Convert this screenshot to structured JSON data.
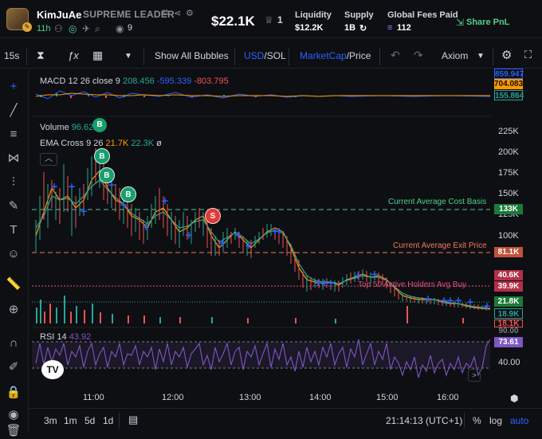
{
  "header": {
    "token_name": "KimJuAe",
    "token_full_name": "SUPREME LEADER",
    "age": "11h",
    "watchers": "9",
    "market_cap": "$22.1K",
    "holders_count": "1",
    "liquidity_label": "Liquidity",
    "liquidity_value": "$12.2K",
    "supply_label": "Supply",
    "supply_value": "1B",
    "fees_label": "Global Fees Paid",
    "fees_value": "112",
    "share_label": "Share PnL"
  },
  "toolbar": {
    "interval": "15s",
    "show_all_bubbles": "Show All Bubbles",
    "currency_usd": "USD",
    "currency_sep": "/",
    "currency_sol": "SOL",
    "mode_marketcap": "MarketCap",
    "mode_sep": "/",
    "mode_price": "Price",
    "source": "Axiom"
  },
  "indicators": {
    "macd_label": "MACD 12 26 close 9",
    "macd_v1": "208.456",
    "macd_v2": "-595.339",
    "macd_v3": "-803.795",
    "volume_label": "Volume",
    "volume_value": "96.62",
    "ema_label": "EMA Cross 9 26",
    "ema_v1": "21.7K",
    "ema_v2": "22.3K",
    "ema_v3": "ø",
    "rsi_label": "RSI 14",
    "rsi_value": "43.92"
  },
  "lines": {
    "avg_cost": "Current Average Cost Basis",
    "avg_exit": "Current Average Exit Price",
    "top50": "Top 50 Active Holders Avg Buy"
  },
  "axis": {
    "macd_tags": [
      "859.947",
      "704.083",
      "155.864"
    ],
    "price_ticks": [
      "225K",
      "200K",
      "175K",
      "150K",
      "125K",
      "100K"
    ],
    "price_tags": [
      "133K",
      "81.1K",
      "40.6K",
      "39.9K",
      "21.8K",
      "18.9K",
      "18.1K"
    ],
    "rsi_tags": [
      "73.61",
      "40.00",
      "90.00"
    ]
  },
  "time_axis": [
    "11:00",
    "12:00",
    "13:00",
    "14:00",
    "15:00",
    "16:00"
  ],
  "bottom": {
    "ranges": [
      "3m",
      "1m",
      "5d",
      "1d"
    ],
    "clock": "21:14:13 (UTC+1)",
    "percent": "%",
    "log": "log",
    "auto": "auto"
  },
  "markers": {
    "buy": "B",
    "sell": "S"
  },
  "colors": {
    "up": "#26a69a",
    "down": "#ef5350",
    "accent": "#2962ff",
    "green_text": "#4fd18b",
    "rsi": "#7e57c2"
  }
}
